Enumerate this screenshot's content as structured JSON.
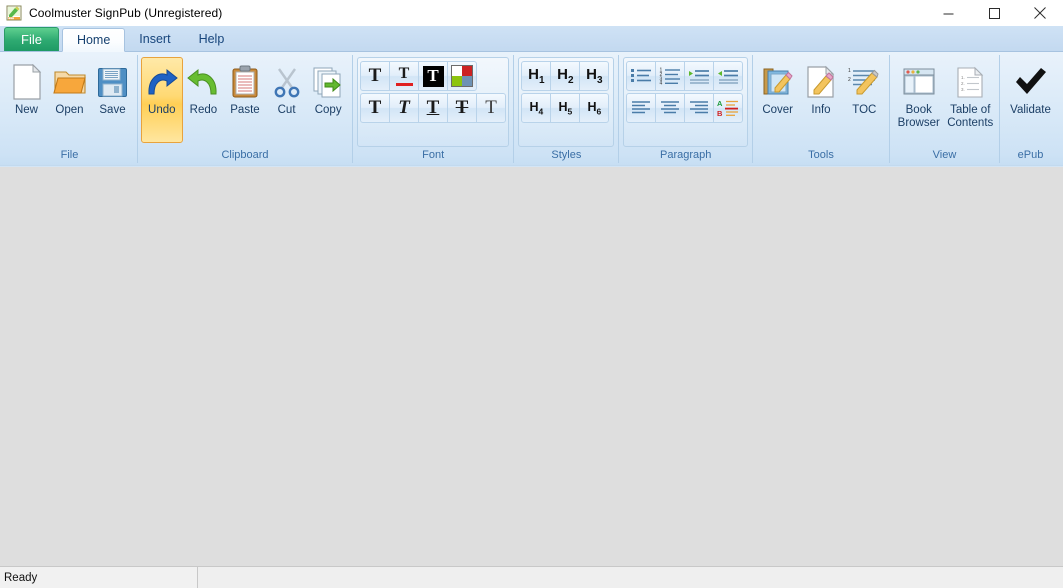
{
  "window": {
    "title": "Coolmuster SignPub (Unregistered)",
    "icon": "app-document-pencil-icon",
    "controls": {
      "minimize": "minimize-icon",
      "maximize": "maximize-icon",
      "close": "close-icon"
    }
  },
  "tabs": [
    {
      "label": "File",
      "active": false,
      "kind": "file"
    },
    {
      "label": "Home",
      "active": true,
      "kind": "normal"
    },
    {
      "label": "Insert",
      "active": false,
      "kind": "normal"
    },
    {
      "label": "Help",
      "active": false,
      "kind": "normal"
    }
  ],
  "ribbon": {
    "groups": [
      {
        "label": "File",
        "buttons": [
          {
            "label": "New",
            "icon": "new-page-icon",
            "state": "normal"
          },
          {
            "label": "Open",
            "icon": "open-folder-icon",
            "state": "normal"
          },
          {
            "label": "Save",
            "icon": "save-floppy-icon",
            "state": "normal"
          }
        ]
      },
      {
        "label": "Clipboard",
        "buttons": [
          {
            "label": "Undo",
            "icon": "undo-arrow-icon",
            "state": "highlighted"
          },
          {
            "label": "Redo",
            "icon": "redo-arrow-icon",
            "state": "normal"
          },
          {
            "label": "Paste",
            "icon": "paste-clipboard-icon",
            "state": "normal"
          },
          {
            "label": "Cut",
            "icon": "cut-scissors-icon",
            "state": "normal"
          },
          {
            "label": "Copy",
            "icon": "copy-pages-icon",
            "state": "normal"
          }
        ]
      },
      {
        "label": "Font",
        "row1": [
          {
            "icon": "font-family-icon",
            "title": "T"
          },
          {
            "icon": "font-color-icon",
            "title": "T"
          },
          {
            "icon": "text-highlight-icon",
            "title": "T"
          },
          {
            "icon": "color-swatch-icon",
            "title": ""
          }
        ],
        "row2": [
          {
            "icon": "bold-icon",
            "title": "T"
          },
          {
            "icon": "italic-icon",
            "title": "T"
          },
          {
            "icon": "underline-icon",
            "title": "T"
          },
          {
            "icon": "strikethrough-icon",
            "title": "T"
          },
          {
            "icon": "clear-formatting-icon",
            "title": "T"
          }
        ]
      },
      {
        "label": "Styles",
        "row1": [
          {
            "icon": "heading-1-icon",
            "label": "H",
            "sub": "1"
          },
          {
            "icon": "heading-2-icon",
            "label": "H",
            "sub": "2"
          },
          {
            "icon": "heading-3-icon",
            "label": "H",
            "sub": "3"
          }
        ],
        "row2": [
          {
            "icon": "heading-4-icon",
            "label": "H",
            "sub": "4"
          },
          {
            "icon": "heading-5-icon",
            "label": "H",
            "sub": "5"
          },
          {
            "icon": "heading-6-icon",
            "label": "H",
            "sub": "6"
          }
        ]
      },
      {
        "label": "Paragraph",
        "row1": [
          {
            "icon": "bulleted-list-icon"
          },
          {
            "icon": "numbered-list-icon"
          },
          {
            "icon": "increase-indent-icon"
          },
          {
            "icon": "decrease-indent-icon"
          }
        ],
        "row2": [
          {
            "icon": "align-left-icon"
          },
          {
            "icon": "align-center-icon"
          },
          {
            "icon": "align-right-icon"
          },
          {
            "icon": "sort-ab-icon"
          }
        ]
      },
      {
        "label": "Tools",
        "buttons": [
          {
            "label": "Cover",
            "icon": "cover-book-pencil-icon",
            "state": "normal"
          },
          {
            "label": "Info",
            "icon": "info-page-pencil-icon",
            "state": "normal"
          },
          {
            "label": "TOC",
            "icon": "toc-pencil-icon",
            "state": "normal"
          }
        ]
      },
      {
        "label": "View",
        "buttons": [
          {
            "label": "Book\nBrowser",
            "line1": "Book",
            "line2": "Browser",
            "icon": "book-browser-window-icon",
            "state": "normal"
          },
          {
            "label": "Table of\nContents",
            "line1": "Table of",
            "line2": "Contents",
            "icon": "table-of-contents-page-icon",
            "state": "normal"
          }
        ]
      },
      {
        "label": "ePub",
        "buttons": [
          {
            "label": "Validate",
            "icon": "validate-checkmark-icon",
            "state": "normal"
          }
        ]
      }
    ]
  },
  "statusbar": {
    "message": "Ready",
    "secondary": ""
  },
  "colors": {
    "file_tab_green": "#2fab72",
    "ribbon_blue": "#dcebf8",
    "group_label_blue": "#3a6ea5",
    "highlight_yellow": "#ffd974",
    "workspace_gray": "#dedede",
    "swatch_white": "#ffffff",
    "swatch_red": "#cc2222",
    "swatch_green": "#8dc40f",
    "swatch_blue": "#6e92b4"
  }
}
